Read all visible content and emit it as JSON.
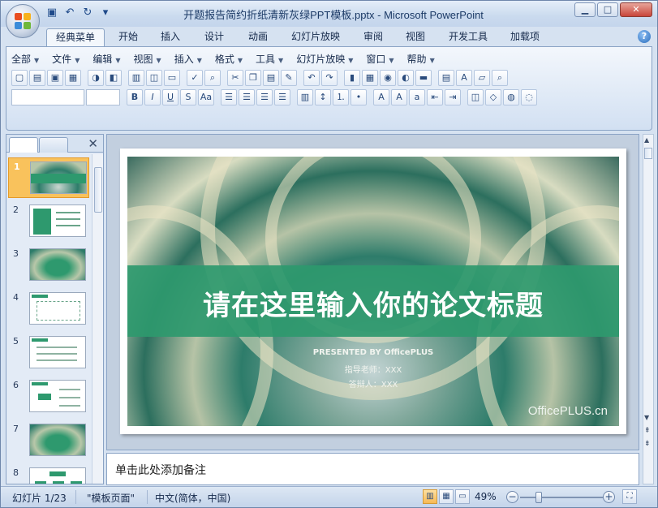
{
  "window": {
    "title": "开题报告简约折纸清新灰绿PPT模板.pptx - Microsoft PowerPoint"
  },
  "quick_access": [
    {
      "name": "save-icon",
      "glyph": "▣"
    },
    {
      "name": "undo-icon",
      "glyph": "↶"
    },
    {
      "name": "redo-icon",
      "glyph": "↻"
    },
    {
      "name": "customize-icon",
      "glyph": "▾"
    }
  ],
  "window_controls": {
    "minimize": "▁",
    "maximize": "□",
    "close": "✕"
  },
  "tabs": [
    "经典菜单",
    "开始",
    "插入",
    "设计",
    "动画",
    "幻灯片放映",
    "审阅",
    "视图",
    "开发工具",
    "加载项"
  ],
  "active_tab": "经典菜单",
  "menubar": [
    "全部",
    "文件",
    "编辑",
    "视图",
    "插入",
    "格式",
    "工具",
    "幻灯片放映",
    "窗口",
    "帮助"
  ],
  "toolbar_row1": [
    "new-icon",
    "open-icon",
    "save-icon",
    "pdf-icon",
    "permission-icon",
    "publish-icon",
    "print-icon",
    "preview-icon",
    "layout-icon",
    "spelling-icon",
    "research-icon",
    "cut-icon",
    "copy-icon",
    "paste-icon",
    "format-painter-icon",
    "undo-icon",
    "redo-icon",
    "chart-icon",
    "table-icon",
    "picture-icon",
    "color-icon",
    "slide-icon",
    "textbox-icon",
    "text-icon",
    "folder-icon",
    "zoom-icon"
  ],
  "toolbar_row2": [
    "bold-icon",
    "italic-icon",
    "underline-icon",
    "shadow-icon",
    "case-icon",
    "align-left-icon",
    "center-icon",
    "align-right-icon",
    "justify-icon",
    "columns-icon",
    "line-spacing-icon",
    "numbering-icon",
    "bullets-icon",
    "font-color-icon",
    "grow-font-icon",
    "shrink-font-icon",
    "decrease-indent-icon",
    "increase-indent-icon",
    "arrange-icon",
    "shapes-icon",
    "shape-fill-icon",
    "shape-outline-icon"
  ],
  "toolbar_glyphs": {
    "bold": "B",
    "italic": "I",
    "underline": "U",
    "shadow": "S",
    "case": "Aa"
  },
  "slides_panel": {
    "count": 8,
    "active": 1,
    "numbers": [
      "1",
      "2",
      "3",
      "4",
      "5",
      "6",
      "7",
      "8"
    ]
  },
  "slide": {
    "title": "请在这里输入你的论文标题",
    "presented_by": "PRESENTED BY OfficePLUS",
    "advisor": "指导老师：XXX",
    "reporter": "答辩人：XXX",
    "brand": "OfficePLUS.cn",
    "banner_color": "#2e996e"
  },
  "notes": {
    "placeholder": "单击此处添加备注"
  },
  "status": {
    "slide_info": "幻灯片 1/23",
    "theme": "\"模板页面\"",
    "language": "中文(简体，中国)",
    "zoom": "49%",
    "zoom_fraction": 0.49
  },
  "colors": {
    "accent": "#2e996e",
    "chrome": "#d6e2f1",
    "active_thumb": "#f9c25c"
  }
}
